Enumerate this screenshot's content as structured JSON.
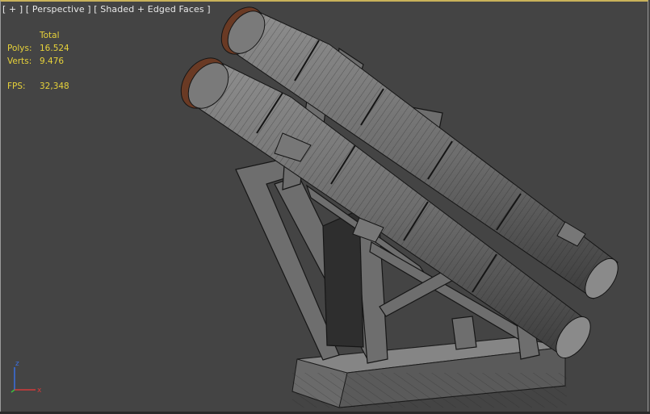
{
  "viewport": {
    "label": "[ + ] [ Perspective ] [ Shaded + Edged Faces ]",
    "colors": {
      "background": "#444444",
      "stats_text": "#e7d23a",
      "label_text": "#e8e8e8",
      "mesh_edge": "#1a1a1a",
      "mesh_fill": "#7a7a7a"
    }
  },
  "stats": {
    "header": "Total",
    "polys_label": "Polys:",
    "polys_value": "16.524",
    "verts_label": "Verts:",
    "verts_value": "9.476",
    "fps_label": "FPS:",
    "fps_value": "32,348"
  },
  "gizmo": {
    "z_label": "z",
    "x_label": "x"
  },
  "icons": [
    "axis-gizmo-icon"
  ]
}
